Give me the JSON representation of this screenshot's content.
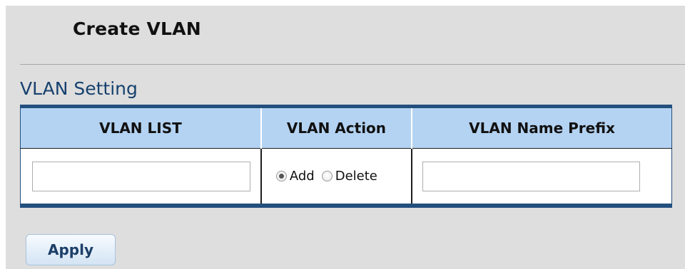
{
  "page": {
    "title": "Create VLAN"
  },
  "section": {
    "title": "VLAN Setting"
  },
  "table": {
    "headers": [
      "VLAN LIST",
      "VLAN Action",
      "VLAN Name Prefix"
    ],
    "row": {
      "vlan_list_value": "",
      "vlan_action": {
        "options": [
          "Add",
          "Delete"
        ],
        "selected": "Add"
      },
      "vlan_name_prefix_value": ""
    }
  },
  "actions": {
    "apply_label": "Apply"
  },
  "colors": {
    "panel_background": "#dedede",
    "header_background": "#b4d3f2",
    "table_border": "#234f7e",
    "section_title": "#17416e",
    "button_text": "#1c3f68"
  }
}
